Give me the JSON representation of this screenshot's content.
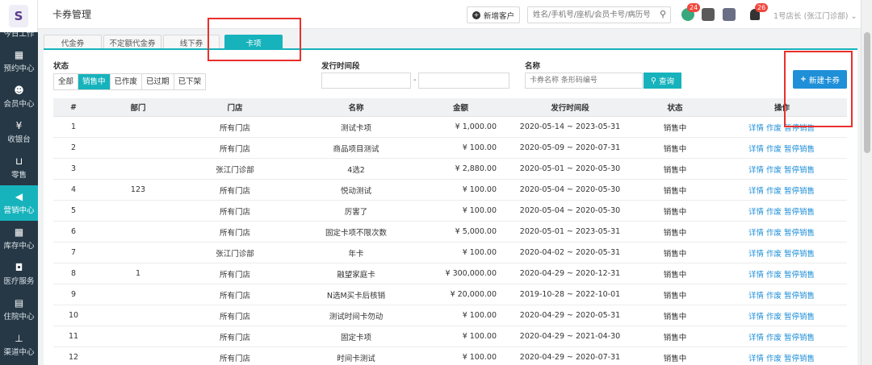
{
  "app": {
    "logo_text": "S",
    "page_title": "卡券管理",
    "new_customer_label": "新增客户",
    "search_placeholder": "姓名/手机号/座机/会员卡号/病历号",
    "badges": [
      "24",
      "26"
    ],
    "user_label": "1号店长 (张江门诊部)"
  },
  "sidebar": {
    "cut_item": "今日工作",
    "items": [
      {
        "label": "预约中心",
        "icon": "calendar-icon"
      },
      {
        "label": "会员中心",
        "icon": "users-icon"
      },
      {
        "label": "收银台",
        "icon": "yen-icon"
      },
      {
        "label": "零售",
        "icon": "cart-icon"
      },
      {
        "label": "营销中心",
        "icon": "megaphone-icon",
        "active": true
      },
      {
        "label": "库存中心",
        "icon": "grid-icon"
      },
      {
        "label": "医疗服务",
        "icon": "medkit-icon"
      },
      {
        "label": "住院中心",
        "icon": "building-icon"
      },
      {
        "label": "渠道中心",
        "icon": "sitemap-icon"
      }
    ]
  },
  "tabs": [
    "代金券",
    "不定额代金券",
    "线下券",
    "卡项"
  ],
  "filters": {
    "status_label": "状态",
    "status_options": [
      "全部",
      "销售中",
      "已作废",
      "已过期",
      "已下架"
    ],
    "status_selected": "销售中",
    "period_label": "发行时间段",
    "name_label": "名称",
    "name_placeholder": "卡券名称 条形码编号",
    "query_label": "查询",
    "new_card_label": "新建卡券"
  },
  "table": {
    "headers": [
      "#",
      "部门",
      "门店",
      "名称",
      "金额",
      "发行时间段",
      "状态",
      "操作"
    ],
    "actions": [
      "详情",
      "作废",
      "暂停销售"
    ],
    "rows": [
      [
        "1",
        "",
        "所有门店",
        "测试卡项",
        "¥ 1,000.00",
        "2020-05-14 ~ 2023-05-31",
        "销售中"
      ],
      [
        "2",
        "",
        "所有门店",
        "商品项目测试",
        "¥ 100.00",
        "2020-05-09 ~ 2020-07-31",
        "销售中"
      ],
      [
        "3",
        "",
        "张江门诊部",
        "4选2",
        "¥ 2,880.00",
        "2020-05-01 ~ 2020-05-30",
        "销售中"
      ],
      [
        "4",
        "123",
        "所有门店",
        "悦动测试",
        "¥ 100.00",
        "2020-05-04 ~ 2020-05-30",
        "销售中"
      ],
      [
        "5",
        "",
        "所有门店",
        "厉害了",
        "¥ 100.00",
        "2020-05-04 ~ 2020-05-30",
        "销售中"
      ],
      [
        "6",
        "",
        "所有门店",
        "固定卡项不限次数",
        "¥ 5,000.00",
        "2020-05-01 ~ 2023-05-31",
        "销售中"
      ],
      [
        "7",
        "",
        "张江门诊部",
        "年卡",
        "¥ 100.00",
        "2020-04-02 ~ 2020-05-31",
        "销售中"
      ],
      [
        "8",
        "1",
        "所有门店",
        "融望家庭卡",
        "¥ 300,000.00",
        "2020-04-29 ~ 2020-12-31",
        "销售中"
      ],
      [
        "9",
        "",
        "所有门店",
        "N选M买卡后核销",
        "¥ 20,000.00",
        "2019-10-28 ~ 2022-10-01",
        "销售中"
      ],
      [
        "10",
        "",
        "所有门店",
        "测试时间卡勿动",
        "¥ 100.00",
        "2020-04-29 ~ 2020-05-31",
        "销售中"
      ],
      [
        "11",
        "",
        "所有门店",
        "固定卡项",
        "¥ 100.00",
        "2020-04-29 ~ 2021-04-30",
        "销售中"
      ],
      [
        "12",
        "",
        "所有门店",
        "时间卡测试",
        "¥ 100.00",
        "2020-04-29 ~ 2020-07-31",
        "销售中"
      ]
    ]
  },
  "colors": {
    "accent": "#17b3bc",
    "sidebar": "#263845",
    "primary_button": "#1f8fd8",
    "annotation_red": "#e8302c"
  }
}
